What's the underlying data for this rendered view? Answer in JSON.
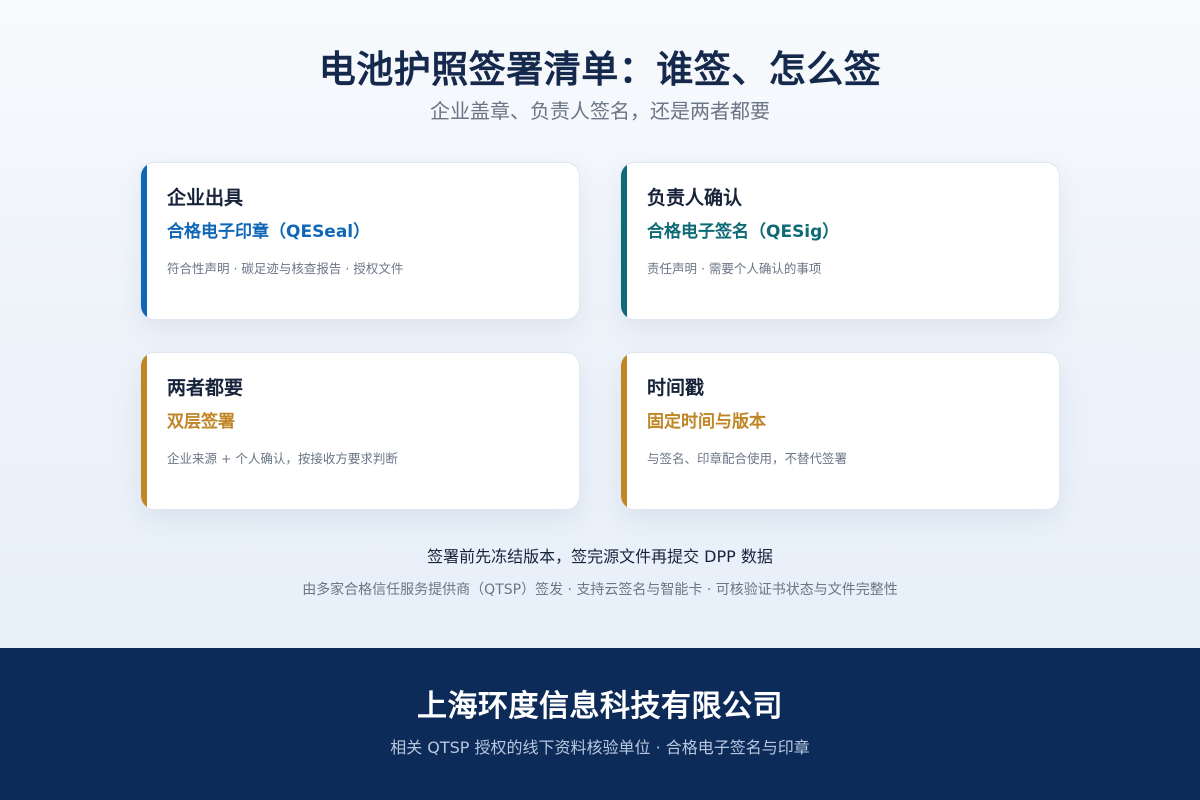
{
  "header": {
    "title": "电池护照签署清单：谁签、怎么签",
    "subtitle": "企业盖章、负责人签名，还是两者都要"
  },
  "cards": [
    {
      "title": "企业出具",
      "subtitle": "合格电子印章（QESeal）",
      "description": "符合性声明 · 碳足迹与核查报告 · 授权文件",
      "accent": "#1067b6"
    },
    {
      "title": "负责人确认",
      "subtitle": "合格电子签名（QESig）",
      "description": "责任声明 · 需要个人确认的事项",
      "accent": "#0f6a77"
    },
    {
      "title": "两者都要",
      "subtitle": "双层签署",
      "description": "企业来源 + 个人确认，按接收方要求判断",
      "accent": "#c08525"
    },
    {
      "title": "时间戳",
      "subtitle": "固定时间与版本",
      "description": "与签名、印章配合使用，不替代签署",
      "accent": "#c08525"
    }
  ],
  "notes": {
    "main": "签署前先冻结版本，签完源文件再提交 DPP 数据",
    "sub": "由多家合格信任服务提供商（QTSP）签发 · 支持云签名与智能卡 · 可核验证书状态与文件完整性"
  },
  "footer": {
    "company": "上海环度信息科技有限公司",
    "tagline": "相关 QTSP 授权的线下资料核验单位 · 合格电子签名与印章",
    "background": "#0d2b59"
  }
}
